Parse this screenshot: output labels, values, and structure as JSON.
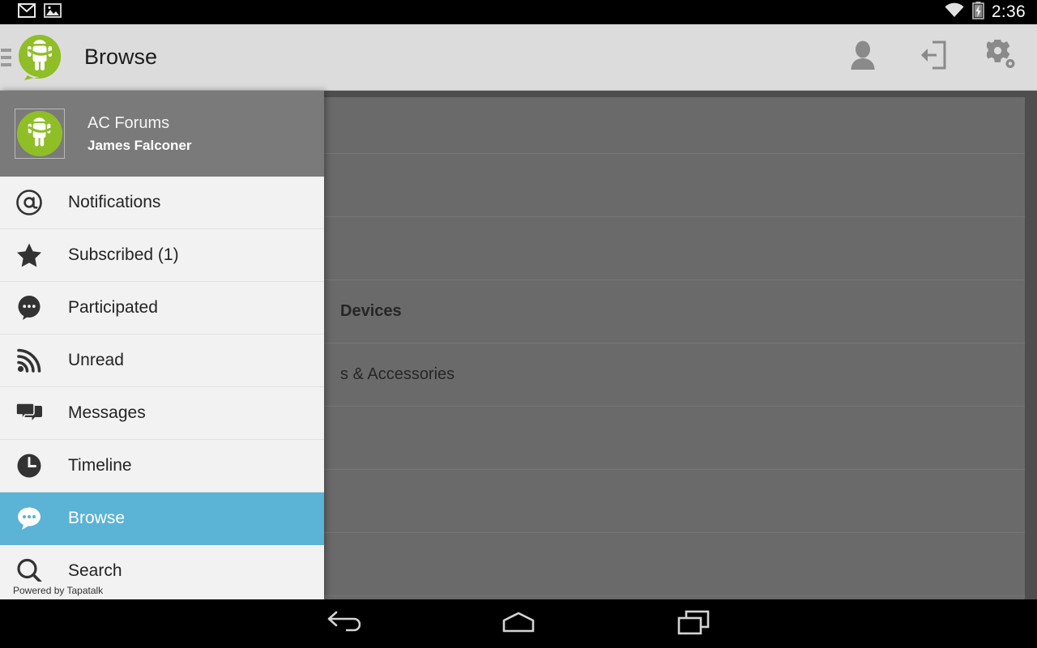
{
  "statusbar": {
    "icons": [
      "mail-icon",
      "image-icon"
    ],
    "wifi_icon": "wifi-icon",
    "battery_icon": "battery-charging-icon",
    "clock": "2:36"
  },
  "actionbar": {
    "logo_icon": "app-logo-icon",
    "title": "Browse",
    "actions": [
      {
        "name": "profile-button",
        "icon": "person-icon"
      },
      {
        "name": "logout-button",
        "icon": "logout-icon"
      },
      {
        "name": "settings-button",
        "icon": "gear-icon"
      }
    ]
  },
  "drawer": {
    "header": {
      "avatar_icon": "android-avatar-icon",
      "forum_name": "AC Forums",
      "user_name": "James Falconer"
    },
    "items": [
      {
        "label": "Notifications",
        "icon": "at-icon",
        "active": false
      },
      {
        "label": "Subscribed (1)",
        "icon": "star-icon",
        "active": false
      },
      {
        "label": "Participated",
        "icon": "comment-icon",
        "active": false
      },
      {
        "label": "Unread",
        "icon": "rss-icon",
        "active": false
      },
      {
        "label": "Messages",
        "icon": "messages-icon",
        "active": false
      },
      {
        "label": "Timeline",
        "icon": "clock-icon",
        "active": false
      },
      {
        "label": "Browse",
        "icon": "browse-icon",
        "active": true
      },
      {
        "label": "Search",
        "icon": "search-icon",
        "active": false
      }
    ],
    "footer": "Powered by Tapatalk",
    "active_color": "#5bb3d6",
    "header_bg": "#7a7a7a",
    "list_bg": "#f2f2f2"
  },
  "content": {
    "rows": [
      {
        "label": "",
        "header": false
      },
      {
        "label": "",
        "header": false
      },
      {
        "label": "",
        "header": false
      },
      {
        "label": "Devices",
        "header": true
      },
      {
        "label": "s & Accessories",
        "header": false
      },
      {
        "label": "",
        "header": false
      },
      {
        "label": "",
        "header": false
      },
      {
        "label": "",
        "header": false
      }
    ]
  },
  "navbar": {
    "buttons": [
      {
        "name": "back-button",
        "icon": "back-icon"
      },
      {
        "name": "home-button",
        "icon": "home-icon"
      },
      {
        "name": "recents-button",
        "icon": "recents-icon"
      }
    ]
  }
}
